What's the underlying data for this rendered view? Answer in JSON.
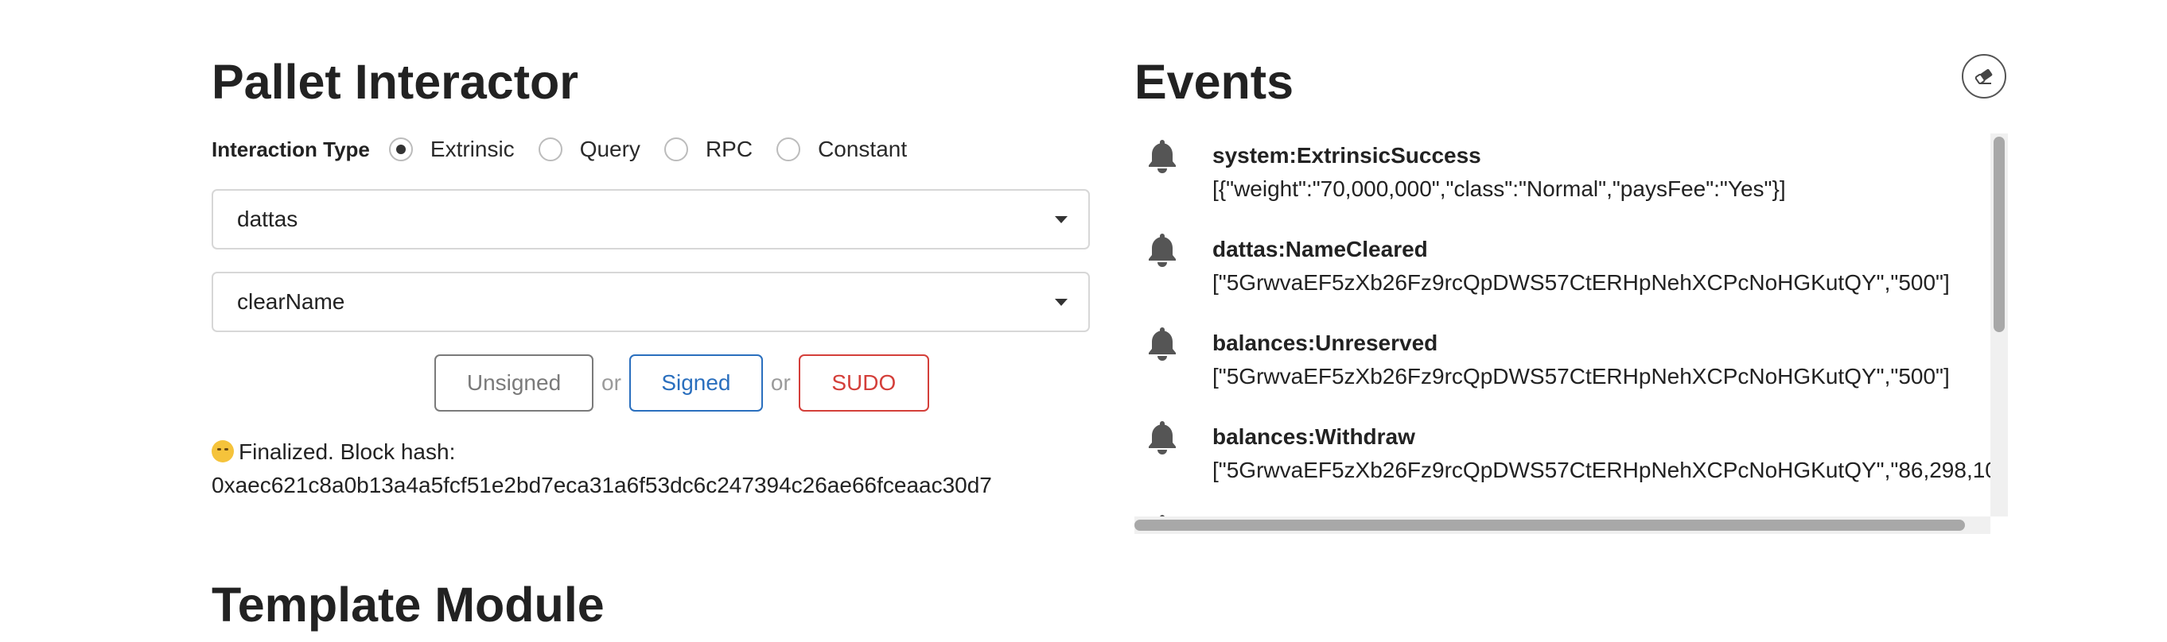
{
  "pallet_interactor": {
    "title": "Pallet Interactor",
    "interaction_type_label": "Interaction Type",
    "interaction_types": [
      {
        "label": "Extrinsic",
        "selected": true
      },
      {
        "label": "Query",
        "selected": false
      },
      {
        "label": "RPC",
        "selected": false
      },
      {
        "label": "Constant",
        "selected": false
      }
    ],
    "pallet_dropdown": {
      "value": "dattas"
    },
    "callable_dropdown": {
      "value": "clearName"
    },
    "buttons": {
      "unsigned": "Unsigned",
      "or": "or",
      "signed": "Signed",
      "sudo": "SUDO"
    },
    "status": {
      "line1": "Finalized. Block hash:",
      "line2": "0xaec621c8a0b13a4a5fcf51e2bd7eca31a6f53dc6c247394c26ae66fceaac30d7",
      "emoji_icon": "smirking-face-icon"
    }
  },
  "events": {
    "title": "Events",
    "clear_icon": "eraser-icon",
    "items": [
      {
        "title": "system:ExtrinsicSuccess",
        "detail": "[{\"weight\":\"70,000,000\",\"class\":\"Normal\",\"paysFee\":\"Yes\"}]",
        "icon": "bell-icon"
      },
      {
        "title": "dattas:NameCleared",
        "detail": "[\"5GrwvaEF5zXb26Fz9rcQpDWS57CtERHpNehXCPcNoHGKutQY\",\"500\"]",
        "icon": "bell-icon"
      },
      {
        "title": "balances:Unreserved",
        "detail": "[\"5GrwvaEF5zXb26Fz9rcQpDWS57CtERHpNehXCPcNoHGKutQY\",\"500\"]",
        "icon": "bell-icon"
      },
      {
        "title": "balances:Withdraw",
        "detail": "[\"5GrwvaEF5zXb26Fz9rcQpDWS57CtERHpNehXCPcNoHGKutQY\",\"86,298,10",
        "icon": "bell-icon"
      }
    ]
  },
  "template_module": {
    "title": "Template Module"
  },
  "colors": {
    "signed": "#2a6fbe",
    "sudo": "#d43f3a",
    "unsigned": "#7a7a7a"
  }
}
